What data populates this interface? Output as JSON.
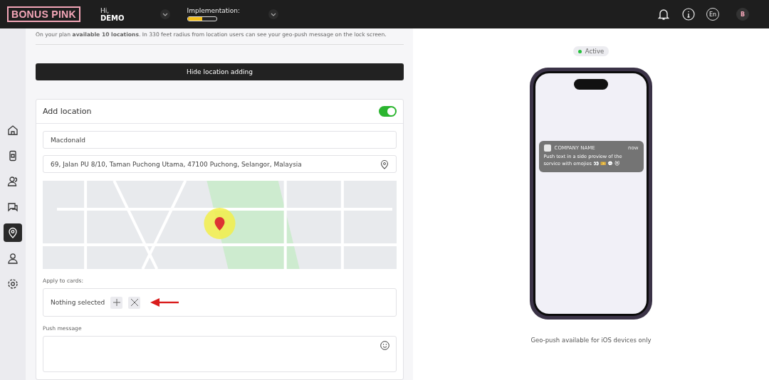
{
  "header": {
    "logo": "BONUS PINK",
    "greeting": "Hi,",
    "user": "DEMO",
    "implementation_label": "Implementation:",
    "implementation": {
      "level": 0.5
    },
    "language": "En",
    "avatar": "B"
  },
  "sidebar": {
    "items": [
      {
        "kind": "home",
        "selected": false
      },
      {
        "kind": "phone",
        "selected": false
      },
      {
        "kind": "people",
        "selected": false
      },
      {
        "kind": "chat",
        "selected": false
      },
      {
        "kind": "pin",
        "selected": true
      },
      {
        "kind": "user",
        "selected": false
      },
      {
        "kind": "settings",
        "selected": false
      }
    ]
  },
  "plan_note": "On your plan **available 10 locations**. In 330 feet radius from location users can see your geo-push message on the lock screen.",
  "hide_button": "Hide location adding",
  "card": {
    "title": "Add location",
    "enabled": true,
    "name_value": "Macdonald",
    "address_value": "69, Jalan PU 8/10, Taman Puchong Utama, 47100 Puchong, Selangor, Malaysia",
    "cards_label": "Apply to cards:",
    "cards_value": "Nothing selected",
    "message_label": "Push message"
  },
  "preview": {
    "status": "Active",
    "notification": {
      "app": "COMPANY NAME",
      "time": "now",
      "text": "Push text in a side preview of the service with emojies 👀 🎫 💬 😻"
    },
    "caption": "Geo-push available for iOS devices only"
  }
}
